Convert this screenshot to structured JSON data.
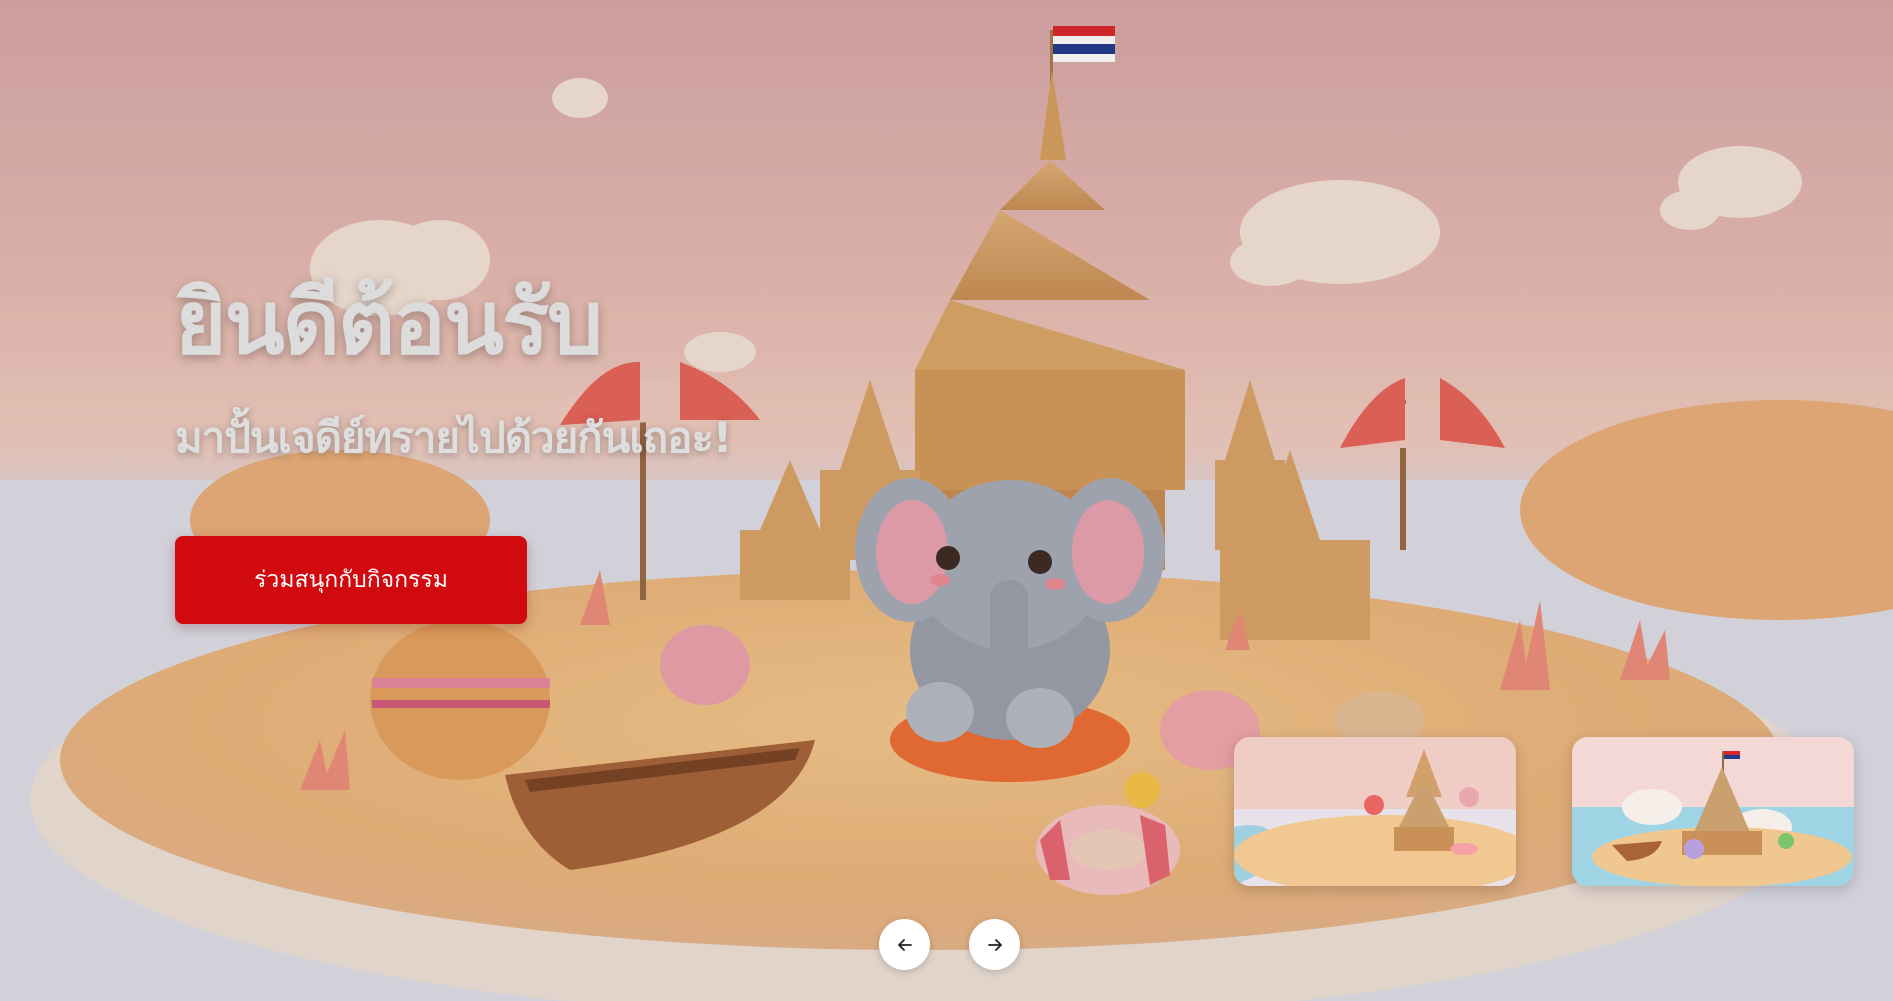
{
  "hero": {
    "title": "ยินดีต้อนรับ",
    "subtitle": "มาปั้นเจดีย์ทรายไปด้วยกันเถอะ!",
    "cta_label": "ร่วมสนุกกับกิจกรรม",
    "background": "sand-pagoda-island-elephant-illustration",
    "cta_color": "#d10a0f"
  },
  "thumbnails": [
    {
      "image": "sand-pagoda-beach-thumbnail"
    },
    {
      "image": "sand-temple-island-boat-thumbnail"
    }
  ],
  "navigation": {
    "prev_icon": "arrow-left-icon",
    "next_icon": "arrow-right-icon"
  }
}
